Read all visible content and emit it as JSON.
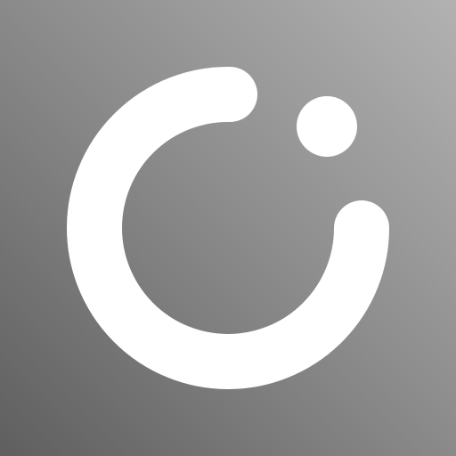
{
  "icon": {
    "name": "app-icon",
    "colors": {
      "gradient_top_right": "#b2b2b2",
      "gradient_mid": "#8a8a8a",
      "gradient_bottom_left": "#5f5f5f",
      "glyph": "#ffffff"
    },
    "glyph": {
      "ring_icon": "open-ring-icon",
      "dot_icon": "dot-icon"
    }
  }
}
